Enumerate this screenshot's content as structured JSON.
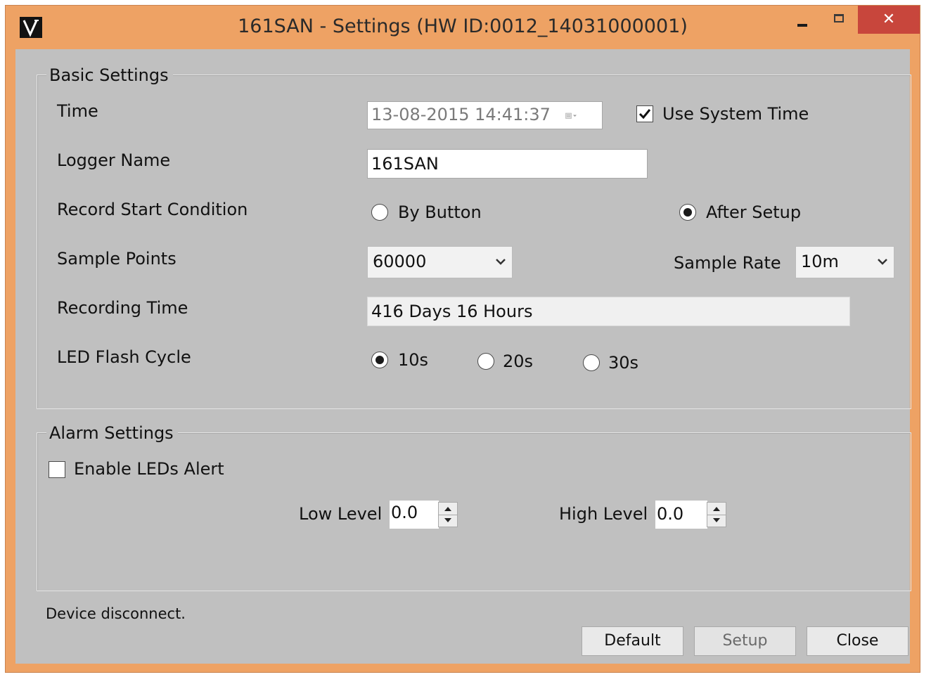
{
  "window": {
    "title": "161SAN - Settings (HW ID:0012_14031000001)",
    "app_icon": "V",
    "controls": {
      "minimize": "minimize-icon",
      "maximize": "maximize-icon",
      "close_label": "✕"
    }
  },
  "basic": {
    "group_label": "Basic Settings",
    "time_label": "Time",
    "time_value": "13-08-2015 14:41:37",
    "use_system_time_label": "Use System Time",
    "use_system_time_checked": true,
    "logger_name_label": "Logger Name",
    "logger_name_value": "161SAN",
    "record_start_label": "Record Start Condition",
    "by_button_label": "By Button",
    "after_setup_label": "After Setup",
    "record_start_selected": "After Setup",
    "sample_points_label": "Sample Points",
    "sample_points_value": "60000",
    "sample_rate_label": "Sample Rate",
    "sample_rate_value": "10m",
    "recording_time_label": "Recording Time",
    "recording_time_value": "416 Days 16 Hours",
    "led_flash_label": "LED Flash Cycle",
    "led_options": [
      "10s",
      "20s",
      "30s"
    ],
    "led_selected": "10s"
  },
  "alarm": {
    "group_label": "Alarm Settings",
    "enable_leds_label": "Enable LEDs Alert",
    "enable_leds_checked": false,
    "low_level_label": "Low Level",
    "low_level_value": "0.0",
    "high_level_label": "High Level",
    "high_level_value": "0.0"
  },
  "status_text": "Device disconnect.",
  "buttons": {
    "default": "Default",
    "setup": "Setup",
    "close": "Close"
  },
  "colors": {
    "title_bar": "#eea264",
    "close_button": "#c8463c",
    "panel": "#c0c0c0"
  }
}
